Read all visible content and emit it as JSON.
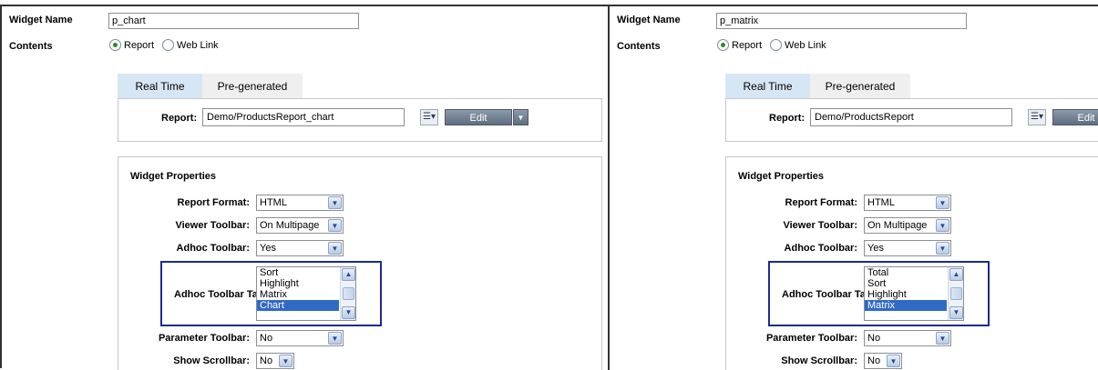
{
  "left": {
    "widget_name_label": "Widget Name",
    "widget_name_value": "p_chart",
    "contents_label": "Contents",
    "radio_report": "Report",
    "radio_weblink": "Web Link",
    "tab_realtime": "Real Time",
    "tab_pregenerated": "Pre-generated",
    "report_label": "Report:",
    "report_value": "Demo/ProductsReport_chart",
    "edit_label": "Edit",
    "props_title": "Widget Properties",
    "report_format_label": "Report Format:",
    "report_format_value": "HTML",
    "viewer_toolbar_label": "Viewer Toolbar:",
    "viewer_toolbar_value": "On Multipage",
    "adhoc_toolbar_label": "Adhoc Toolbar:",
    "adhoc_toolbar_value": "Yes",
    "adhoc_tabs_label": "Adhoc Toolbar Tabs:",
    "adhoc_tabs_options": [
      "Sort",
      "Highlight",
      "Matrix",
      "Chart"
    ],
    "adhoc_tabs_selected": "Chart",
    "parameter_toolbar_label": "Parameter Toolbar:",
    "parameter_toolbar_value": "No",
    "show_scrollbar_label": "Show Scrollbar:",
    "show_scrollbar_value": "No"
  },
  "right": {
    "widget_name_label": "Widget Name",
    "widget_name_value": "p_matrix",
    "contents_label": "Contents",
    "radio_report": "Report",
    "radio_weblink": "Web Link",
    "tab_realtime": "Real Time",
    "tab_pregenerated": "Pre-generated",
    "report_label": "Report:",
    "report_value": "Demo/ProductsReport",
    "edit_label": "Edit",
    "props_title": "Widget Properties",
    "report_format_label": "Report Format:",
    "report_format_value": "HTML",
    "viewer_toolbar_label": "Viewer Toolbar:",
    "viewer_toolbar_value": "On Multipage",
    "adhoc_toolbar_label": "Adhoc Toolbar:",
    "adhoc_toolbar_value": "Yes",
    "adhoc_tabs_label": "Adhoc Toolbar Tabs:",
    "adhoc_tabs_options": [
      "Total",
      "Sort",
      "Highlight",
      "Matrix"
    ],
    "adhoc_tabs_selected": "Matrix",
    "parameter_toolbar_label": "Parameter Toolbar:",
    "parameter_toolbar_value": "No",
    "show_scrollbar_label": "Show Scrollbar:",
    "show_scrollbar_value": "No"
  },
  "colors": {
    "highlight_border": "#1c2a8e",
    "tab_active_bg": "#d6e6f4",
    "list_selected_bg": "#316ac5"
  }
}
